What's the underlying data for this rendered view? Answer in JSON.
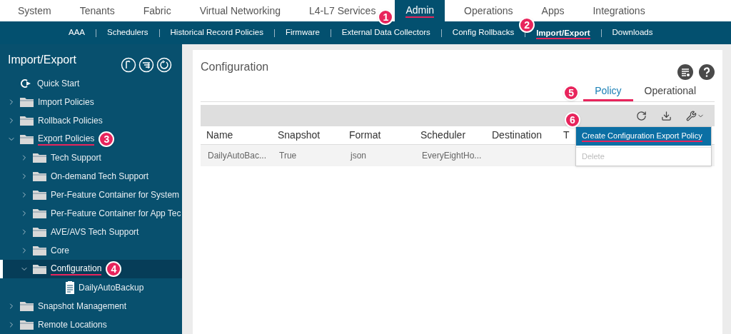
{
  "top_nav": [
    {
      "label": "System",
      "selected": false
    },
    {
      "label": "Tenants",
      "selected": false
    },
    {
      "label": "Fabric",
      "selected": false
    },
    {
      "label": "Virtual Networking",
      "selected": false
    },
    {
      "label": "L4-L7 Services",
      "selected": false
    },
    {
      "label": "Admin",
      "selected": true,
      "callout": "1"
    },
    {
      "label": "Operations",
      "selected": false
    },
    {
      "label": "Apps",
      "selected": false
    },
    {
      "label": "Integrations",
      "selected": false
    }
  ],
  "sub_nav": [
    {
      "label": "AAA",
      "selected": false
    },
    {
      "label": "Schedulers",
      "selected": false
    },
    {
      "label": "Historical Record Policies",
      "selected": false
    },
    {
      "label": "Firmware",
      "selected": false
    },
    {
      "label": "External Data Collectors",
      "selected": false
    },
    {
      "label": "Config Rollbacks",
      "selected": false
    },
    {
      "label": "Import/Export",
      "selected": true,
      "callout": "2"
    },
    {
      "label": "Downloads",
      "selected": false
    }
  ],
  "sidebar": {
    "title": "Import/Export",
    "items": [
      {
        "kind": "quickstart",
        "label": "Quick Start",
        "selected": false
      },
      {
        "kind": "folder",
        "label": "Import Policies",
        "expanded": false,
        "selected": false
      },
      {
        "kind": "folder",
        "label": "Rollback Policies",
        "expanded": false,
        "selected": false
      },
      {
        "kind": "folder",
        "label": "Export Policies",
        "expanded": true,
        "selected": false,
        "callout": "3",
        "children": [
          {
            "kind": "folder",
            "label": "Tech Support",
            "expanded": false,
            "selected": false
          },
          {
            "kind": "folder",
            "label": "On-demand Tech Support",
            "expanded": false,
            "selected": false
          },
          {
            "kind": "folder",
            "label": "Per-Feature Container for System",
            "expanded": false,
            "selected": false
          },
          {
            "kind": "folder",
            "label": "Per-Feature Container for App Tec",
            "expanded": false,
            "selected": false
          },
          {
            "kind": "folder",
            "label": "AVE/AVS Tech Support",
            "expanded": false,
            "selected": false
          },
          {
            "kind": "folder",
            "label": "Core",
            "expanded": false,
            "selected": false
          },
          {
            "kind": "folder",
            "label": "Configuration",
            "expanded": true,
            "selected": true,
            "callout": "4",
            "children": [
              {
                "kind": "file",
                "label": "DailyAutoBackup",
                "selected": false
              }
            ]
          }
        ]
      },
      {
        "kind": "folder",
        "label": "Snapshot Management",
        "expanded": false,
        "selected": false
      },
      {
        "kind": "folder",
        "label": "Remote Locations",
        "expanded": false,
        "selected": false
      }
    ]
  },
  "panel": {
    "title": "Configuration",
    "tabs": [
      {
        "label": "Policy",
        "selected": true,
        "callout": "5"
      },
      {
        "label": "Operational",
        "selected": false
      }
    ],
    "table": {
      "columns": [
        "Name",
        "Snapshot",
        "Format",
        "Scheduler",
        "Destination",
        "T"
      ],
      "rows": [
        [
          "DailyAutoBac...",
          "True",
          "json",
          "EveryEightHo...",
          ""
        ]
      ]
    },
    "menu": {
      "callout": "6",
      "items": [
        {
          "label": "Create Configuration Export Policy",
          "selected": true,
          "disabled": false
        },
        {
          "label": "Delete",
          "selected": false,
          "disabled": true
        }
      ]
    }
  }
}
